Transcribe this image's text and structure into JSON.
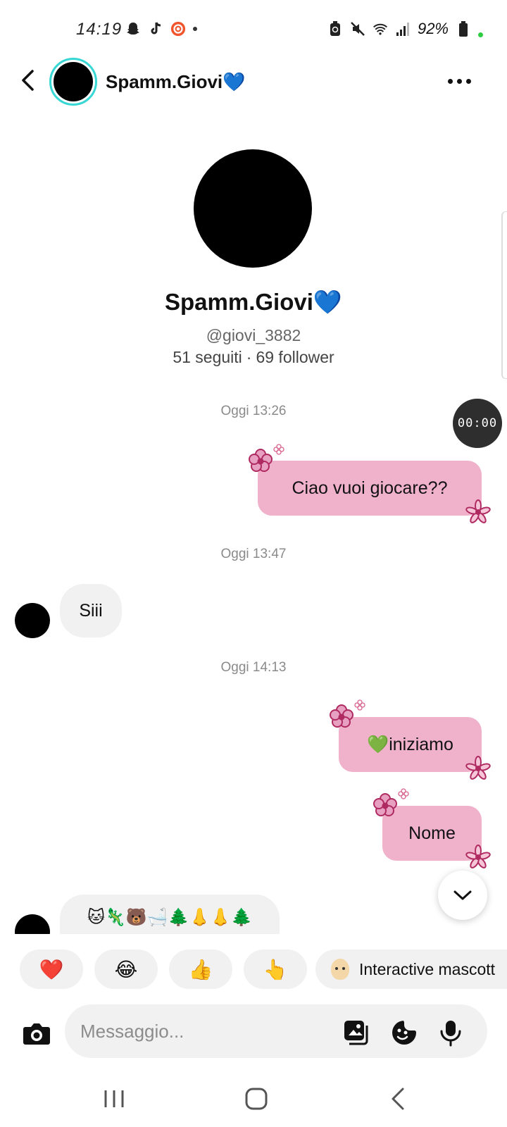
{
  "status_bar": {
    "time": "14:19",
    "battery": "92%",
    "left_icons": [
      "snapchat-icon",
      "tiktok-icon",
      "screen-recorder-icon",
      "notification-dot"
    ],
    "right_icons": [
      "battery-saver-icon",
      "mute-icon",
      "wifi-icon",
      "signal-icon",
      "battery-icon"
    ]
  },
  "header": {
    "name": "Spamm.Giovi💙"
  },
  "profile": {
    "name": "Spamm.Giovi💙",
    "handle": "@giovi_3882",
    "following": "51 seguiti",
    "separator": "·",
    "followers": "69 follower"
  },
  "timer": "00:00",
  "messages": [
    {
      "type": "timestamp",
      "text": "Oggi 13:26"
    },
    {
      "type": "outgoing",
      "text": "Ciao vuoi giocare??"
    },
    {
      "type": "timestamp",
      "text": "Oggi 13:47"
    },
    {
      "type": "incoming",
      "text": "Siii"
    },
    {
      "type": "timestamp",
      "text": "Oggi 14:13"
    },
    {
      "type": "outgoing",
      "text": "💚iniziamo"
    },
    {
      "type": "outgoing",
      "text": "Nome"
    },
    {
      "type": "incoming",
      "text": "🐱🦎🐻🛁🌲👃👃🌲"
    }
  ],
  "quick_reactions": [
    "❤️",
    "😂",
    "👍",
    "👆"
  ],
  "mascot_label": "Interactive mascott",
  "composer": {
    "placeholder": "Messaggio..."
  },
  "colors": {
    "outgoing_bubble": "#f0b2cb",
    "incoming_bubble": "#f1f1f2",
    "avatar_ring": "#37d7d3",
    "flower": "#c2336b"
  }
}
